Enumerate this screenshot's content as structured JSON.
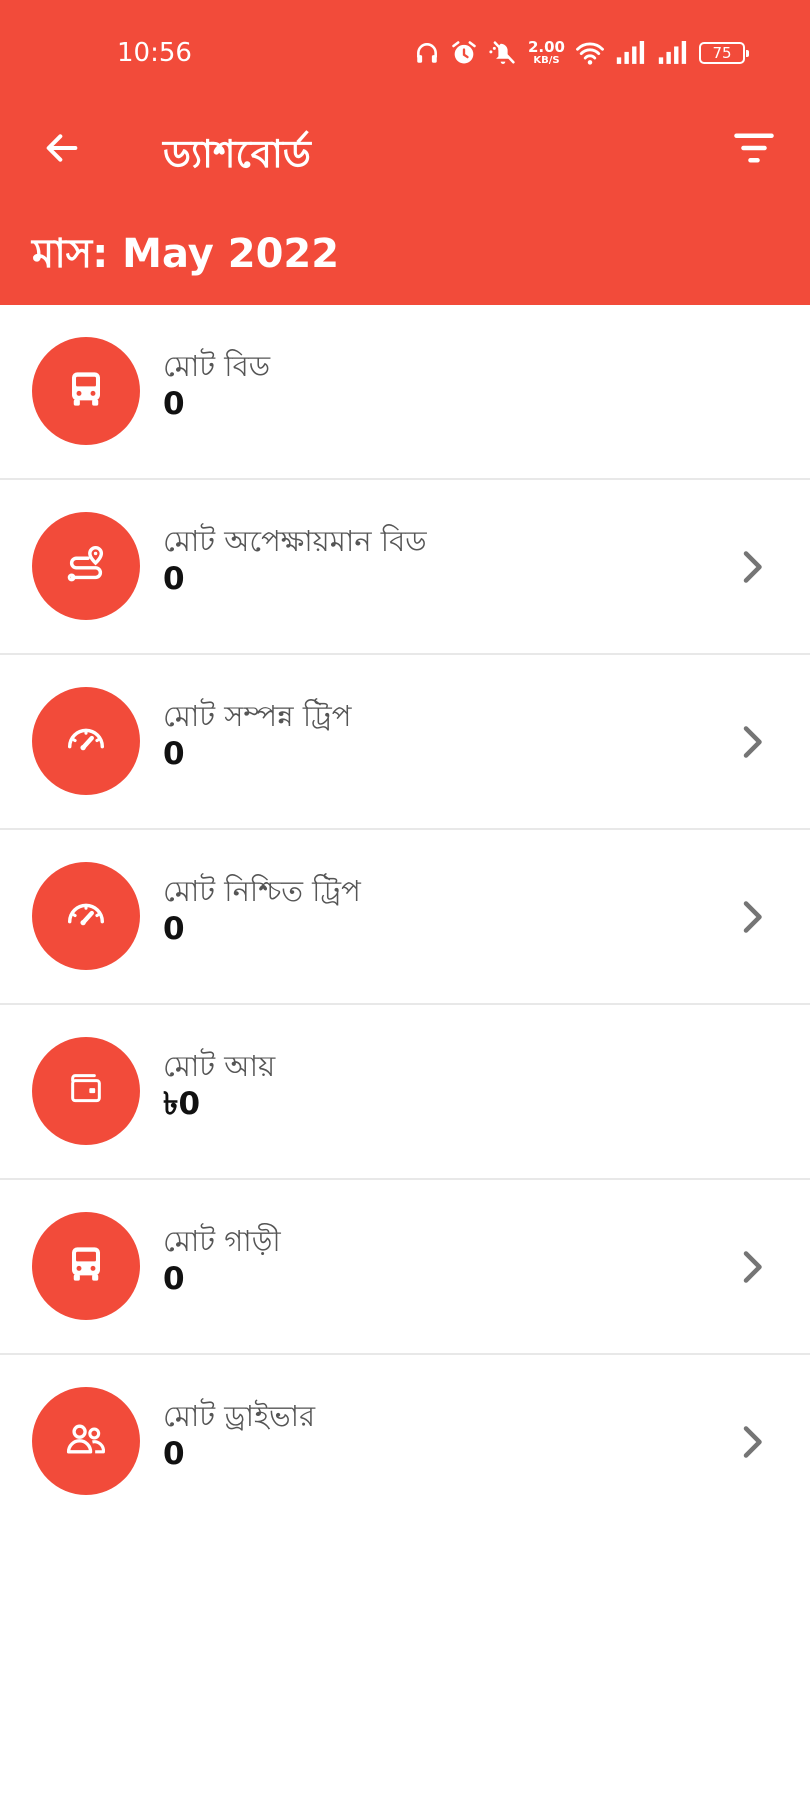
{
  "status_bar": {
    "time": "10:56",
    "net_speed_value": "2.00",
    "net_speed_unit": "KB/S",
    "battery": "75"
  },
  "toolbar": {
    "title": "ড্যাশবোর্ড",
    "back_icon": "arrow-left-icon",
    "filter_icon": "filter-icon"
  },
  "month": {
    "label": "মাস:",
    "value": "May 2022"
  },
  "colors": {
    "primary": "#f24b3a",
    "label_text": "#555555",
    "value_text": "#111111",
    "divider": "#e8e8e8",
    "chevron": "#757575"
  },
  "stats": [
    {
      "label": "মোট বিড",
      "value": "0",
      "icon": "bus-icon",
      "has_chevron": false
    },
    {
      "label": "মোট অপেক্ষায়মান বিড",
      "value": "0",
      "icon": "route-pin-icon",
      "has_chevron": true
    },
    {
      "label": "মোট সম্পন্ন ট্রিপ",
      "value": "0",
      "icon": "speedometer-icon",
      "has_chevron": true
    },
    {
      "label": "মোট নিশ্চিত ট্রিপ",
      "value": "0",
      "icon": "speedometer-icon",
      "has_chevron": true
    },
    {
      "label": "মোট আয়",
      "value": "৳0",
      "icon": "wallet-icon",
      "has_chevron": false
    },
    {
      "label": "মোট গাড়ী",
      "value": "0",
      "icon": "bus-icon",
      "has_chevron": true
    },
    {
      "label": "মোট ড্রাইভার",
      "value": "0",
      "icon": "people-icon",
      "has_chevron": true
    }
  ]
}
